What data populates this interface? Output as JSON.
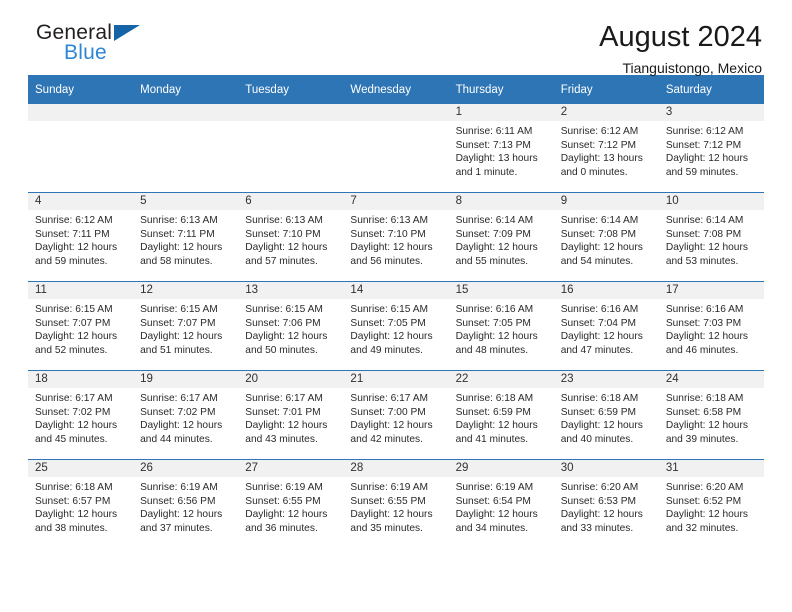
{
  "brand": {
    "name_part1": "General",
    "name_part2": "Blue",
    "flag_icon": "brand-triangle-icon"
  },
  "header": {
    "title": "August 2024",
    "subtitle": "Tianguistongo, Mexico"
  },
  "calendar": {
    "weekday_headers": [
      "Sunday",
      "Monday",
      "Tuesday",
      "Wednesday",
      "Thursday",
      "Friday",
      "Saturday"
    ],
    "accent_color": "#2E75B6",
    "band_color": "#F1F1F1",
    "weeks": [
      [
        {
          "day": "",
          "sunrise": "",
          "sunset": "",
          "daylight_line1": "",
          "daylight_line2": ""
        },
        {
          "day": "",
          "sunrise": "",
          "sunset": "",
          "daylight_line1": "",
          "daylight_line2": ""
        },
        {
          "day": "",
          "sunrise": "",
          "sunset": "",
          "daylight_line1": "",
          "daylight_line2": ""
        },
        {
          "day": "",
          "sunrise": "",
          "sunset": "",
          "daylight_line1": "",
          "daylight_line2": ""
        },
        {
          "day": "1",
          "sunrise": "Sunrise: 6:11 AM",
          "sunset": "Sunset: 7:13 PM",
          "daylight_line1": "Daylight: 13 hours",
          "daylight_line2": "and 1 minute."
        },
        {
          "day": "2",
          "sunrise": "Sunrise: 6:12 AM",
          "sunset": "Sunset: 7:12 PM",
          "daylight_line1": "Daylight: 13 hours",
          "daylight_line2": "and 0 minutes."
        },
        {
          "day": "3",
          "sunrise": "Sunrise: 6:12 AM",
          "sunset": "Sunset: 7:12 PM",
          "daylight_line1": "Daylight: 12 hours",
          "daylight_line2": "and 59 minutes."
        }
      ],
      [
        {
          "day": "4",
          "sunrise": "Sunrise: 6:12 AM",
          "sunset": "Sunset: 7:11 PM",
          "daylight_line1": "Daylight: 12 hours",
          "daylight_line2": "and 59 minutes."
        },
        {
          "day": "5",
          "sunrise": "Sunrise: 6:13 AM",
          "sunset": "Sunset: 7:11 PM",
          "daylight_line1": "Daylight: 12 hours",
          "daylight_line2": "and 58 minutes."
        },
        {
          "day": "6",
          "sunrise": "Sunrise: 6:13 AM",
          "sunset": "Sunset: 7:10 PM",
          "daylight_line1": "Daylight: 12 hours",
          "daylight_line2": "and 57 minutes."
        },
        {
          "day": "7",
          "sunrise": "Sunrise: 6:13 AM",
          "sunset": "Sunset: 7:10 PM",
          "daylight_line1": "Daylight: 12 hours",
          "daylight_line2": "and 56 minutes."
        },
        {
          "day": "8",
          "sunrise": "Sunrise: 6:14 AM",
          "sunset": "Sunset: 7:09 PM",
          "daylight_line1": "Daylight: 12 hours",
          "daylight_line2": "and 55 minutes."
        },
        {
          "day": "9",
          "sunrise": "Sunrise: 6:14 AM",
          "sunset": "Sunset: 7:08 PM",
          "daylight_line1": "Daylight: 12 hours",
          "daylight_line2": "and 54 minutes."
        },
        {
          "day": "10",
          "sunrise": "Sunrise: 6:14 AM",
          "sunset": "Sunset: 7:08 PM",
          "daylight_line1": "Daylight: 12 hours",
          "daylight_line2": "and 53 minutes."
        }
      ],
      [
        {
          "day": "11",
          "sunrise": "Sunrise: 6:15 AM",
          "sunset": "Sunset: 7:07 PM",
          "daylight_line1": "Daylight: 12 hours",
          "daylight_line2": "and 52 minutes."
        },
        {
          "day": "12",
          "sunrise": "Sunrise: 6:15 AM",
          "sunset": "Sunset: 7:07 PM",
          "daylight_line1": "Daylight: 12 hours",
          "daylight_line2": "and 51 minutes."
        },
        {
          "day": "13",
          "sunrise": "Sunrise: 6:15 AM",
          "sunset": "Sunset: 7:06 PM",
          "daylight_line1": "Daylight: 12 hours",
          "daylight_line2": "and 50 minutes."
        },
        {
          "day": "14",
          "sunrise": "Sunrise: 6:15 AM",
          "sunset": "Sunset: 7:05 PM",
          "daylight_line1": "Daylight: 12 hours",
          "daylight_line2": "and 49 minutes."
        },
        {
          "day": "15",
          "sunrise": "Sunrise: 6:16 AM",
          "sunset": "Sunset: 7:05 PM",
          "daylight_line1": "Daylight: 12 hours",
          "daylight_line2": "and 48 minutes."
        },
        {
          "day": "16",
          "sunrise": "Sunrise: 6:16 AM",
          "sunset": "Sunset: 7:04 PM",
          "daylight_line1": "Daylight: 12 hours",
          "daylight_line2": "and 47 minutes."
        },
        {
          "day": "17",
          "sunrise": "Sunrise: 6:16 AM",
          "sunset": "Sunset: 7:03 PM",
          "daylight_line1": "Daylight: 12 hours",
          "daylight_line2": "and 46 minutes."
        }
      ],
      [
        {
          "day": "18",
          "sunrise": "Sunrise: 6:17 AM",
          "sunset": "Sunset: 7:02 PM",
          "daylight_line1": "Daylight: 12 hours",
          "daylight_line2": "and 45 minutes."
        },
        {
          "day": "19",
          "sunrise": "Sunrise: 6:17 AM",
          "sunset": "Sunset: 7:02 PM",
          "daylight_line1": "Daylight: 12 hours",
          "daylight_line2": "and 44 minutes."
        },
        {
          "day": "20",
          "sunrise": "Sunrise: 6:17 AM",
          "sunset": "Sunset: 7:01 PM",
          "daylight_line1": "Daylight: 12 hours",
          "daylight_line2": "and 43 minutes."
        },
        {
          "day": "21",
          "sunrise": "Sunrise: 6:17 AM",
          "sunset": "Sunset: 7:00 PM",
          "daylight_line1": "Daylight: 12 hours",
          "daylight_line2": "and 42 minutes."
        },
        {
          "day": "22",
          "sunrise": "Sunrise: 6:18 AM",
          "sunset": "Sunset: 6:59 PM",
          "daylight_line1": "Daylight: 12 hours",
          "daylight_line2": "and 41 minutes."
        },
        {
          "day": "23",
          "sunrise": "Sunrise: 6:18 AM",
          "sunset": "Sunset: 6:59 PM",
          "daylight_line1": "Daylight: 12 hours",
          "daylight_line2": "and 40 minutes."
        },
        {
          "day": "24",
          "sunrise": "Sunrise: 6:18 AM",
          "sunset": "Sunset: 6:58 PM",
          "daylight_line1": "Daylight: 12 hours",
          "daylight_line2": "and 39 minutes."
        }
      ],
      [
        {
          "day": "25",
          "sunrise": "Sunrise: 6:18 AM",
          "sunset": "Sunset: 6:57 PM",
          "daylight_line1": "Daylight: 12 hours",
          "daylight_line2": "and 38 minutes."
        },
        {
          "day": "26",
          "sunrise": "Sunrise: 6:19 AM",
          "sunset": "Sunset: 6:56 PM",
          "daylight_line1": "Daylight: 12 hours",
          "daylight_line2": "and 37 minutes."
        },
        {
          "day": "27",
          "sunrise": "Sunrise: 6:19 AM",
          "sunset": "Sunset: 6:55 PM",
          "daylight_line1": "Daylight: 12 hours",
          "daylight_line2": "and 36 minutes."
        },
        {
          "day": "28",
          "sunrise": "Sunrise: 6:19 AM",
          "sunset": "Sunset: 6:55 PM",
          "daylight_line1": "Daylight: 12 hours",
          "daylight_line2": "and 35 minutes."
        },
        {
          "day": "29",
          "sunrise": "Sunrise: 6:19 AM",
          "sunset": "Sunset: 6:54 PM",
          "daylight_line1": "Daylight: 12 hours",
          "daylight_line2": "and 34 minutes."
        },
        {
          "day": "30",
          "sunrise": "Sunrise: 6:20 AM",
          "sunset": "Sunset: 6:53 PM",
          "daylight_line1": "Daylight: 12 hours",
          "daylight_line2": "and 33 minutes."
        },
        {
          "day": "31",
          "sunrise": "Sunrise: 6:20 AM",
          "sunset": "Sunset: 6:52 PM",
          "daylight_line1": "Daylight: 12 hours",
          "daylight_line2": "and 32 minutes."
        }
      ]
    ]
  }
}
